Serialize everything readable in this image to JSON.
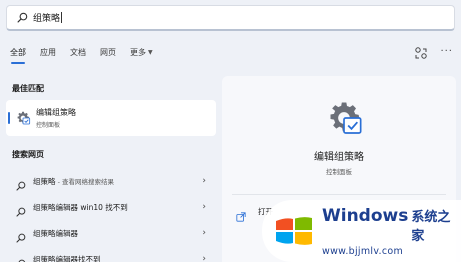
{
  "search": {
    "query": "组策略"
  },
  "tabs": [
    {
      "label": "全部",
      "active": true
    },
    {
      "label": "应用",
      "active": false
    },
    {
      "label": "文档",
      "active": false
    },
    {
      "label": "网页",
      "active": false
    },
    {
      "label": "更多",
      "active": false
    }
  ],
  "best_match": {
    "section_label": "最佳匹配",
    "title": "编辑组策略",
    "subtitle": "控制面板"
  },
  "web_search": {
    "section_label": "搜索网页",
    "items": [
      {
        "text": "组策略",
        "suffix": " - 查看网络搜索结果"
      },
      {
        "text": "组策略编辑器 win10 找不到",
        "suffix": ""
      },
      {
        "text": "组策略编辑器",
        "suffix": ""
      },
      {
        "text": "组策略编辑器找不到",
        "suffix": ""
      }
    ]
  },
  "detail": {
    "title": "编辑组策略",
    "subtitle": "控制面板",
    "open_label": "打开"
  },
  "watermark": {
    "brand": "Windows",
    "brand_cn": "系统之家",
    "url": "www.bjjmlv.com"
  },
  "colors": {
    "accent": "#2a6fd6",
    "background": "#eef1f7",
    "watermark_blue": "#1d3f8f"
  }
}
